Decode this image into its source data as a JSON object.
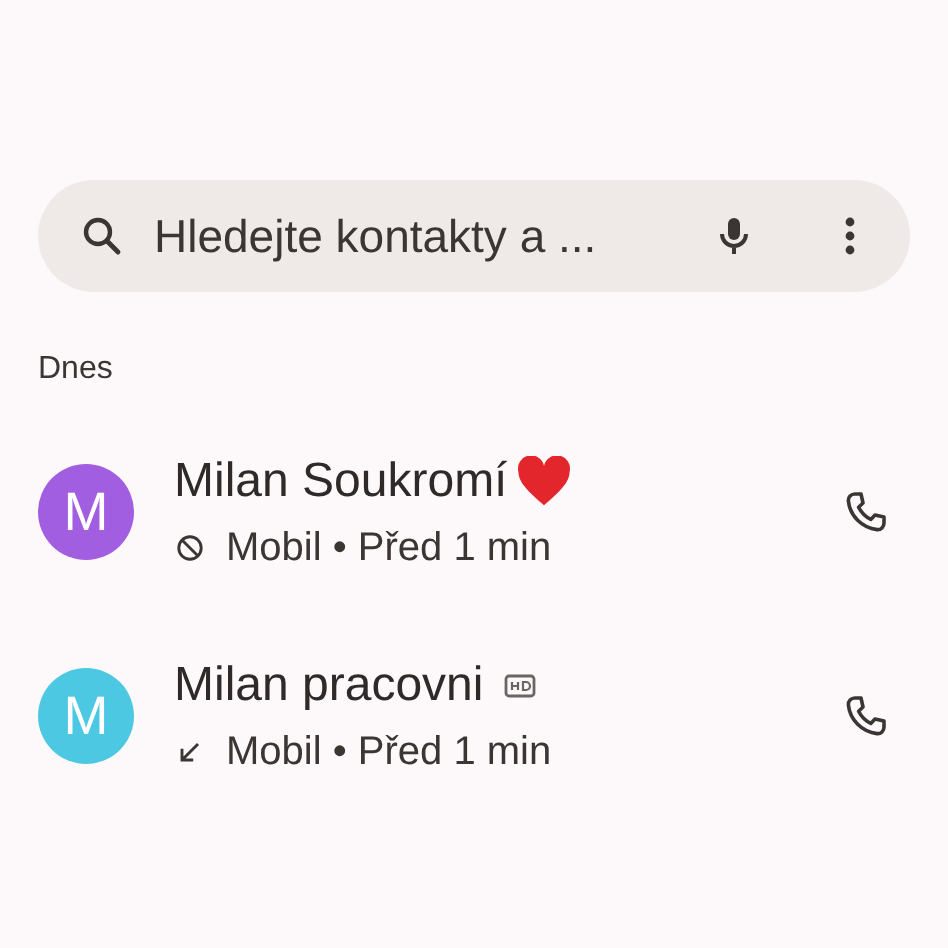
{
  "search": {
    "placeholder": "Hledejte kontakty a ..."
  },
  "section": "Dnes",
  "calls": [
    {
      "initial": "M",
      "color": "#a25ee0",
      "name": "Milan Soukromí",
      "badge": {
        "kind": "heart"
      },
      "call_icon": {
        "kind": "blocked"
      },
      "detail": "Mobil • Před 1 min"
    },
    {
      "initial": "M",
      "color": "#4cc8e3",
      "name": "Milan pracovni",
      "badge": {
        "kind": "hd"
      },
      "call_icon": {
        "kind": "incoming"
      },
      "detail": "Mobil • Před 1 min"
    }
  ]
}
